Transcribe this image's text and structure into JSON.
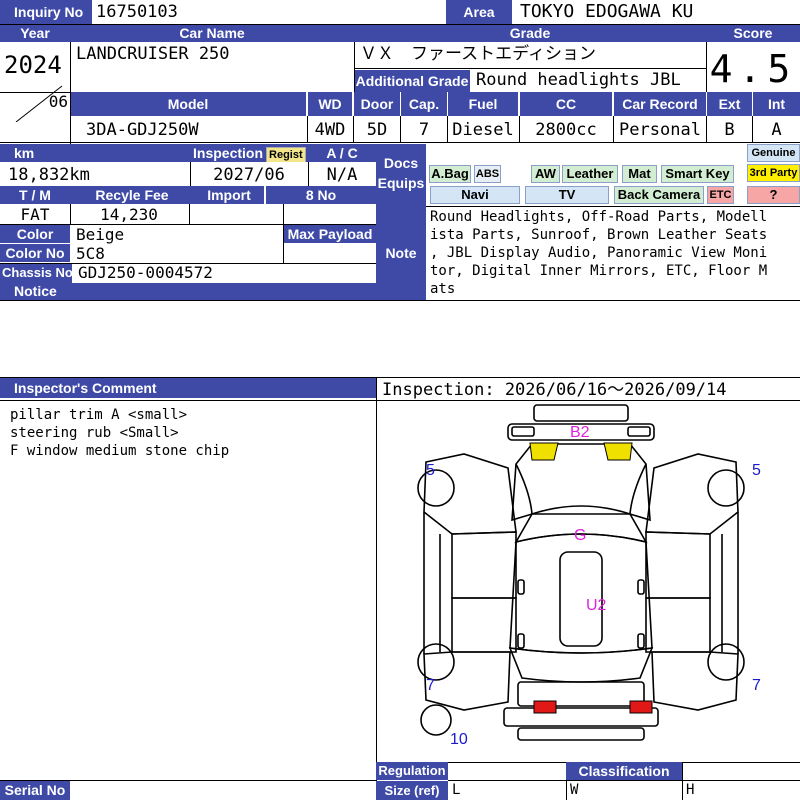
{
  "labels": {
    "inquiry_no": "Inquiry No",
    "area": "Area",
    "year": "Year",
    "car_name": "Car Name",
    "grade": "Grade",
    "score": "Score",
    "additional_grade": "Additional Grade",
    "model": "Model",
    "wd": "WD",
    "door": "Door",
    "cap": "Cap.",
    "fuel": "Fuel",
    "cc": "CC",
    "car_record": "Car Record",
    "ext": "Ext",
    "int": "Int",
    "km": "km",
    "inspection": "Inspection",
    "regist": "Regist",
    "ac": "A / C",
    "docs_equips_1": "Docs",
    "docs_equips_2": "Equips",
    "tm": "T / M",
    "recycle_fee": "Recyle Fee",
    "import": "Import",
    "no8": "8 No",
    "color": "Color",
    "max_payload": "Max Payload",
    "color_no": "Color No",
    "note": "Note",
    "chassis_no": "Chassis No",
    "notice": "Notice",
    "inspectors_comment": "Inspector's Comment",
    "regulation": "Regulation",
    "classification": "Classification",
    "size_ref": "Size (ref)",
    "serial_no": "Serial No",
    "size_l": "L",
    "size_w": "W",
    "size_h": "H"
  },
  "values": {
    "inquiry_no": "16750103",
    "area": "TOKYO EDOGAWA KU",
    "year": "2024",
    "month": "06",
    "car_name": "LANDCRUISER 250",
    "grade": "ＶＸ　ファーストエディション",
    "score": "4.5",
    "additional_grade": "Round headlights JBL",
    "model": "3DA-GDJ250W",
    "wd": "4WD",
    "door": "5D",
    "cap": "7",
    "fuel": "Diesel",
    "cc": "2800cc",
    "car_record": "Personal",
    "ext": "B",
    "int": "A",
    "km": "18,832km",
    "inspection": "2027/06",
    "ac": "N/A",
    "tm": "FAT",
    "recycle_fee": "14,230",
    "import": "",
    "no8": "",
    "color": "Beige",
    "max_payload": "",
    "color_no": "5C8",
    "chassis_no": "GDJ250-0004572",
    "note": "Round Headlights, Off-Road Parts, Modellista Parts, Sunroof, Brown Leather Seats, JBL Display Audio, Panoramic View Monitor, Digital Inner Mirrors, ETC, Floor Mats",
    "note_lines": [
      "Round Headlights, Off-Road Parts, Modell",
      "ista Parts, Sunroof, Brown Leather Seats",
      ", JBL Display Audio, Panoramic View Moni",
      "tor, Digital Inner Mirrors, ETC, Floor M",
      "ats"
    ],
    "inspection_period": "Inspection: 2026/06/16〜2026/09/14",
    "comments": [
      "pillar trim A <small>",
      "steering rub <Small>",
      "F window medium stone chip"
    ]
  },
  "equips": {
    "abag": "A.Bag",
    "abs": "ABS",
    "aw": "AW",
    "leather": "Leather",
    "mat": "Mat",
    "smart_key": "Smart Key",
    "genuine": "Genuine",
    "third_party": "3rd Party",
    "navi": "Navi",
    "tv": "TV",
    "back_camera": "Back Camera",
    "etc": "ETC",
    "question": "?"
  },
  "diagram_marks": {
    "b2": "B2",
    "g": "G",
    "u2": "U2",
    "lf": "5",
    "rf": "5",
    "lr": "7",
    "rr": "7",
    "spare": "10"
  },
  "colors": {
    "header_bg": "#3e4aa6",
    "mark_blue": "#1a1acc",
    "mark_magenta": "#dd22dd",
    "lamp_front": "#f0e000",
    "lamp_rear": "#e01818"
  }
}
